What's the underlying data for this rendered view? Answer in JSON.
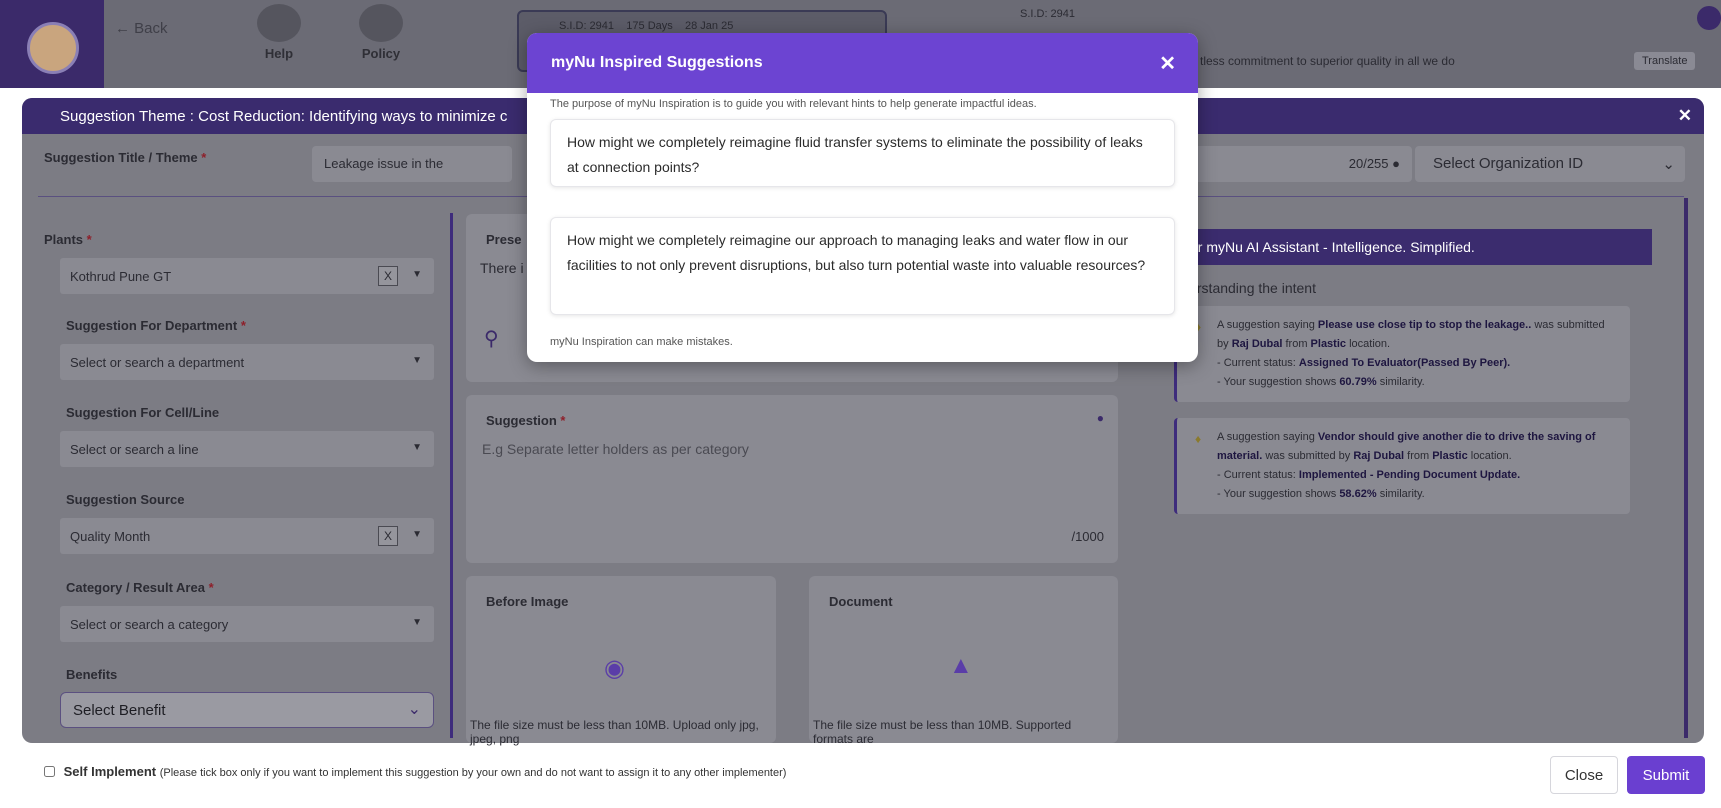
{
  "header": {
    "back_label": "Back",
    "help_label": "Help",
    "policy_label": "Policy",
    "sid": "S.I.D: 2941",
    "days": "175 Days",
    "date": "28 Jan 25",
    "sid2": "S.I.D: 2941",
    "motto": "tless commitment to superior quality in all we do",
    "translate_label": "Translate"
  },
  "panel": {
    "theme": "Suggestion Theme : Cost Reduction: Identifying ways to minimize c",
    "title_label": "Suggestion Title / Theme",
    "title_value": "Leakage issue in the",
    "title_count": "20/255",
    "org_placeholder": "Select Organization ID"
  },
  "fields": {
    "plants_label": "Plants",
    "plants_value": "Kothrud Pune GT",
    "department_label": "Suggestion For Department",
    "department_placeholder": "Select or search a department",
    "cell_label": "Suggestion For Cell/Line",
    "cell_placeholder": "Select or search a line",
    "source_label": "Suggestion Source",
    "source_value": "Quality Month",
    "category_label": "Category / Result Area",
    "category_placeholder": "Select or search a category",
    "benefits_label": "Benefits",
    "benefits_value": "Select Benefit",
    "clear_label": "X",
    "required_mark": "*"
  },
  "middle": {
    "present_title": "Prese",
    "present_text": "There i",
    "suggestion_label": "Suggestion",
    "suggestion_placeholder": "E.g Separate letter holders as per category",
    "suggestion_count": "/1000",
    "before_image_label": "Before Image",
    "before_image_note": "The file size must be less than 10MB. Upload only jpg, jpeg, png",
    "document_label": "Document",
    "document_note": "The file size must be less than 10MB. Supported formats are"
  },
  "assistant": {
    "title": "ur myNu AI Assistant - Intelligence. Simplified.",
    "intent": "lerstanding the intent",
    "cards": [
      {
        "prefix": "A suggestion saying",
        "title": "Please use close tip to stop the leakage..",
        "was": "was submitted by",
        "by": "Raj Dubal",
        "from": "from",
        "location": "Plastic",
        "loc_suffix": "location.",
        "status_label": "- Current status:",
        "status": "Assigned To Evaluator(Passed By Peer).",
        "sim_label": "- Your suggestion shows",
        "similarity": "60.79%",
        "sim_suffix": "similarity."
      },
      {
        "prefix": "A suggestion saying",
        "title": "Vendor should give another die to drive the saving of material.",
        "was": "was submitted by",
        "by": "Raj Dubal",
        "from": "from",
        "location": "Plastic",
        "loc_suffix": "location.",
        "status_label": "- Current status:",
        "status": "Implemented - Pending Document Update.",
        "sim_label": "- Your suggestion shows",
        "similarity": "58.62%",
        "sim_suffix": "similarity."
      }
    ]
  },
  "footer": {
    "self_implement_label": "Self Implement",
    "self_implement_note": "(Please tick box only if you want to implement this suggestion by your own and do not want to assign it to any other implementer)",
    "close_label": "Close",
    "submit_label": "Submit"
  },
  "dialog": {
    "title": "myNu Inspired Suggestions",
    "close_glyph": "✕",
    "subtitle": "The purpose of myNu Inspiration is to guide you with relevant hints to help generate impactful ideas.",
    "suggestions": [
      "How might we completely reimagine fluid transfer systems to eliminate the possibility of leaks at connection points?",
      "How might we completely reimagine our approach to managing leaks and water flow in our facilities to not only prevent disruptions, but also turn potential waste into valuable resources?"
    ],
    "footer": "myNu Inspiration can make mistakes."
  },
  "colors": {
    "accent": "#6c44d2",
    "submit": "#6a3fd0",
    "overlay_header": "#3a2b6e"
  },
  "icons": [
    "back-arrow-icon",
    "help-icon",
    "policy-download-icon",
    "mic-icon",
    "camera-icon",
    "file-upload-icon",
    "bulb-icon",
    "close-icon",
    "chevron-down-icon"
  ]
}
